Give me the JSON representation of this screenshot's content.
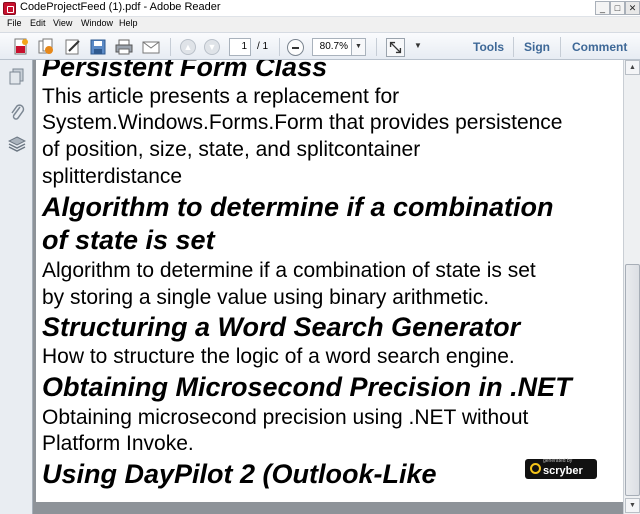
{
  "window": {
    "title": "CodeProjectFeed (1).pdf - Adobe Reader",
    "minimize_label": "_",
    "maximize_label": "□",
    "close_label": "✕"
  },
  "menu": {
    "items": [
      {
        "label": "File"
      },
      {
        "label": "Edit"
      },
      {
        "label": "View"
      },
      {
        "label": "Window"
      },
      {
        "label": "Help"
      }
    ]
  },
  "toolbar": {
    "icons": [
      "create-pdf-icon",
      "combine-files-icon",
      "edit-icon",
      "save-icon",
      "print-icon",
      "email-icon"
    ],
    "current_page": "1",
    "total_pages": "/ 1",
    "zoom": "80.7%",
    "zoom_dropdown_glyph": "▼",
    "more_glyph": "▼",
    "links": {
      "tools": "Tools",
      "sign": "Sign",
      "comment": "Comment"
    },
    "accent_color": "#3e6897"
  },
  "navpane": {
    "icons": [
      "pages-icon",
      "attachments-icon",
      "layers-icon"
    ]
  },
  "document": {
    "entries": [
      {
        "heading": "Persistent Form Class",
        "body": [
          "This article presents a replacement for",
          "System.Windows.Forms.Form that provides persistence",
          "of position, size, state, and splitcontainer",
          "splitterdistance"
        ]
      },
      {
        "heading": "Algorithm to determine if a combination",
        "heading2": "of state is set",
        "body": [
          "Algorithm to determine if a combination of state is set",
          "by storing a single value using binary arithmetic."
        ]
      },
      {
        "heading": "Structuring a Word Search Generator",
        "body": [
          "How to structure the logic of a word search engine."
        ]
      },
      {
        "heading": "Obtaining Microsecond Precision in .NET",
        "body": [
          "Obtaining microsecond precision using .NET without",
          "Platform Invoke."
        ]
      },
      {
        "heading": "Using DayPilot 2 (Outlook-Like",
        "body": []
      }
    ],
    "badge": {
      "caption": "generated by",
      "name": "scryber"
    }
  },
  "scrollbar": {
    "up_glyph": "▲",
    "down_glyph": "▼"
  }
}
